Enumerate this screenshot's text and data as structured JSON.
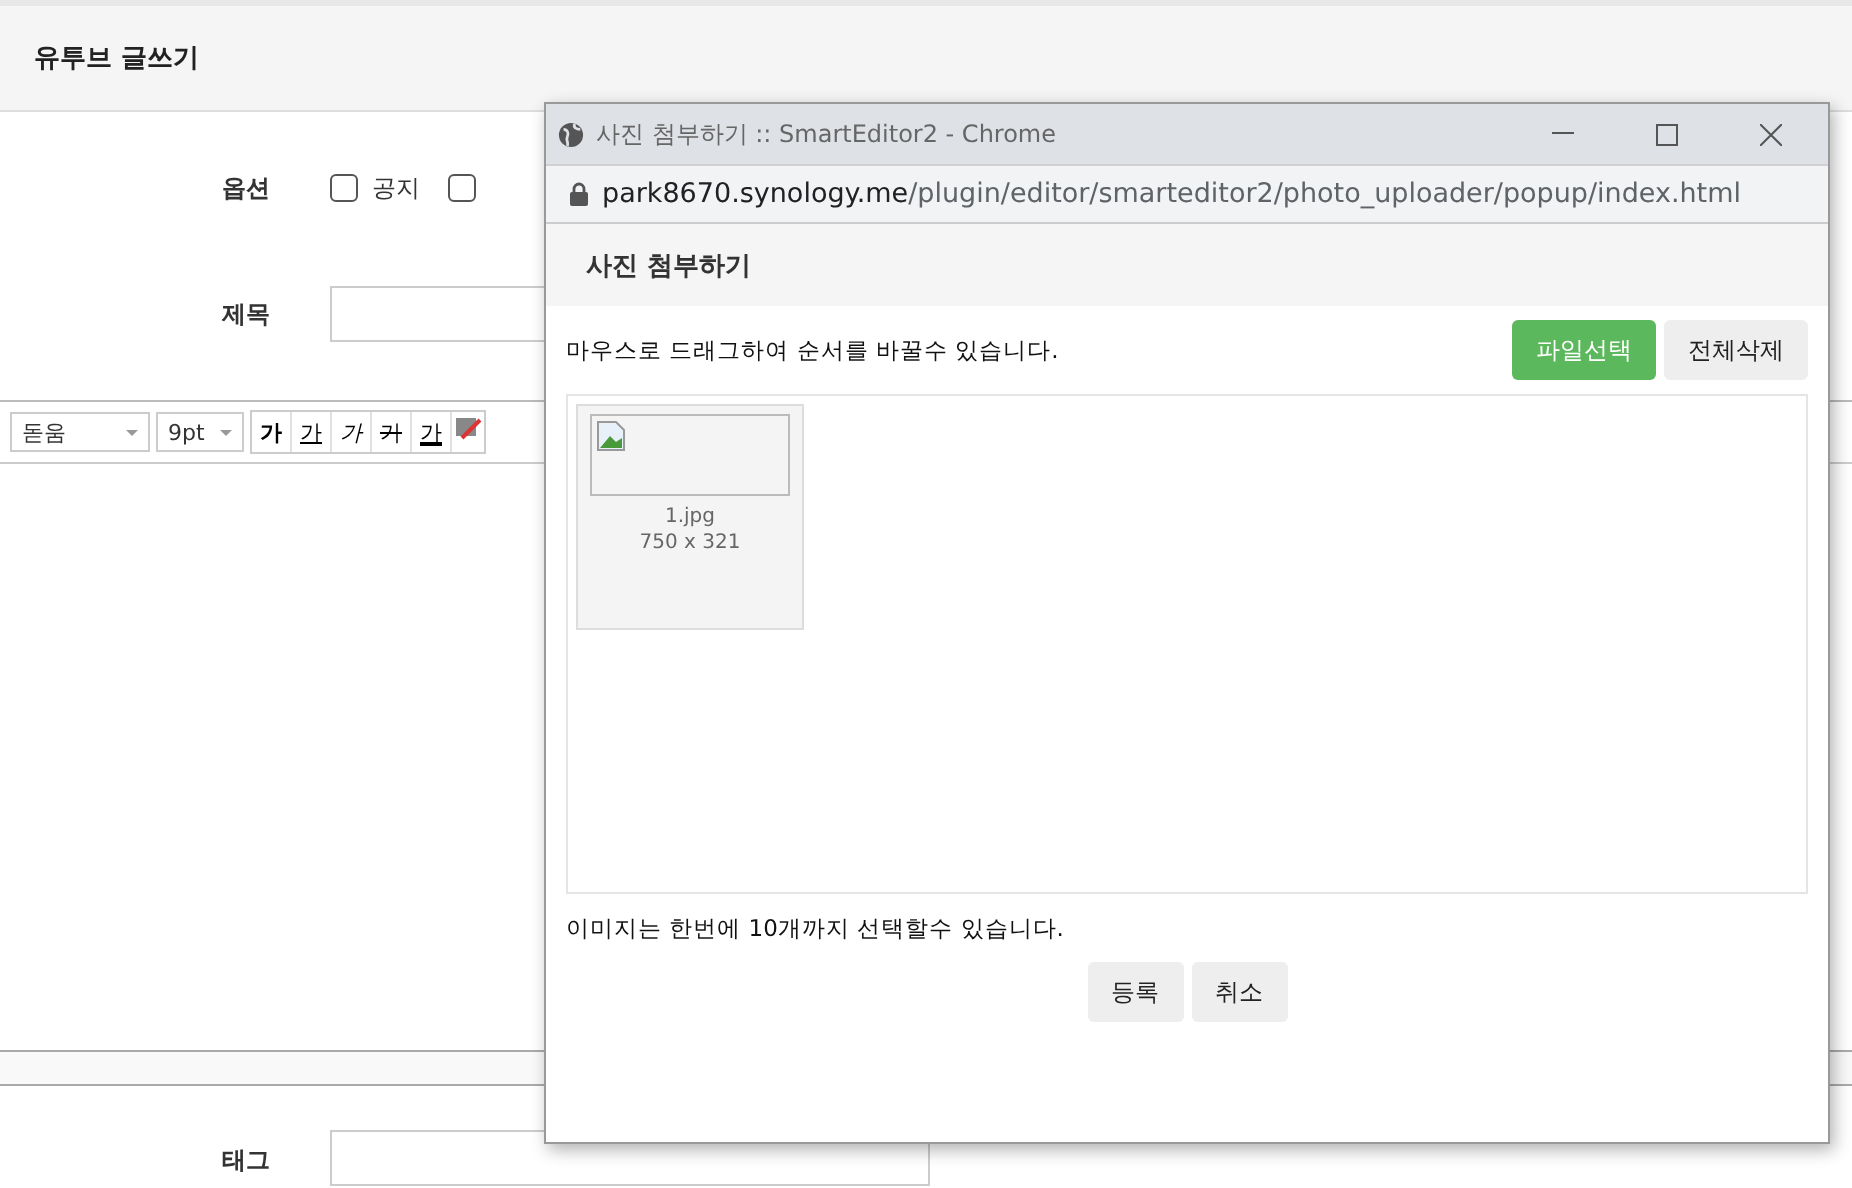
{
  "page": {
    "title": "유투브 글쓰기"
  },
  "form": {
    "option_label": "옵션",
    "options": [
      {
        "label": "공지",
        "checked": false
      },
      {
        "checked": false
      }
    ],
    "title_label": "제목",
    "tag_label": "태그"
  },
  "editor_toolbar": {
    "font": "돋움",
    "size": "9pt",
    "styles": [
      {
        "kind": "bold",
        "glyph": "가"
      },
      {
        "kind": "underline",
        "glyph": "가"
      },
      {
        "kind": "italic",
        "glyph": "가"
      },
      {
        "kind": "strike",
        "glyph": "가"
      },
      {
        "kind": "color",
        "glyph": "가"
      }
    ]
  },
  "popup": {
    "window_title": "사진 첨부하기 :: SmartEditor2 - Chrome",
    "url_host": "park8670.synology.me",
    "url_path": "/plugin/editor/smarteditor2/photo_uploader/popup/index.html",
    "heading": "사진 첨부하기",
    "hint": "마우스로 드래그하여 순서를 바꿀수 있습니다.",
    "select_button": "파일선택",
    "delete_all_button": "전체삭제",
    "files": [
      {
        "name": "1.jpg",
        "size": "750 x 321"
      }
    ],
    "limit_note": "이미지는 한번에 10개까지 선택할수 있습니다.",
    "buttons": [
      "등록",
      "취소"
    ]
  }
}
